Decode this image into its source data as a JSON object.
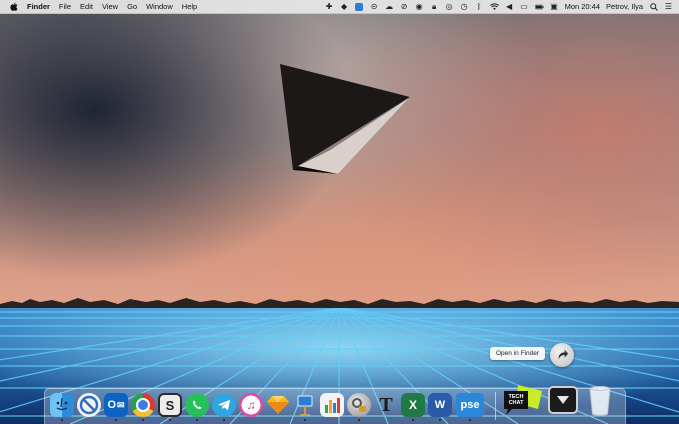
{
  "menubar": {
    "app_name": "Finder",
    "menus": [
      "File",
      "Edit",
      "View",
      "Go",
      "Window",
      "Help"
    ],
    "clock": "Mon 20:44",
    "user": "Petrov, Ilya"
  },
  "tooltip": {
    "text": "Open in Finder"
  },
  "dock": {
    "outlook_letter": "O",
    "sketchbook_letter": "S",
    "font_app_letter": "T",
    "excel_letter": "X",
    "word_letter": "W",
    "pse_label": "pse",
    "techchat_line1": "TECH",
    "techchat_line2": "CHAT"
  },
  "colors": {
    "accent": "#2d7fd6",
    "grid_glow": "#55c8f5"
  }
}
